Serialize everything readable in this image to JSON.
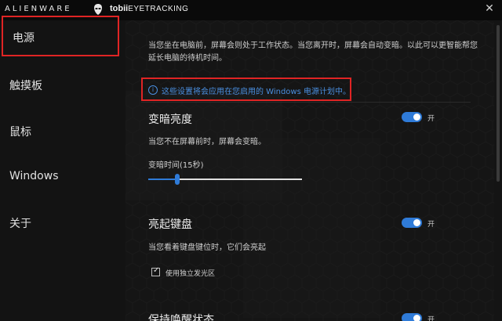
{
  "titlebar": {
    "brand": "ALIENWARE",
    "tobii_bold": "tobii",
    "tobii_rest": "EYETRACKING",
    "close_glyph": "✕"
  },
  "sidebar": {
    "items": [
      {
        "label": "电源",
        "active": true
      },
      {
        "label": "触摸板",
        "active": false
      },
      {
        "label": "鼠标",
        "active": false
      },
      {
        "label": "Windows",
        "active": false
      },
      {
        "label": "关于",
        "active": false
      }
    ]
  },
  "main": {
    "intro": "当您坐在电脑前，屏幕会则处于工作状态。当您离开时，屏幕会自动变暗。以此可以更智能帮您延长电脑的待机时间。",
    "notice": "这些设置将会应用在您启用的 Windows 电源计划中。",
    "dim": {
      "title": "变暗亮度",
      "toggle_label": "开",
      "desc": "当您不在屏幕前时，屏幕会变暗。",
      "slider_label": "变暗时间(15秒)",
      "slider_fraction": 0.19
    },
    "keyboard": {
      "title": "亮起键盘",
      "toggle_label": "开",
      "desc": "当您看着键盘键位时，它们会亮起",
      "checkbox_label": "使用独立发光区",
      "checkbox_checked": true
    },
    "partial_section": {
      "title": "保持唤醒状态",
      "toggle_label": "开"
    }
  },
  "colors": {
    "accent": "#2f7bd8",
    "highlight": "#e02424"
  }
}
